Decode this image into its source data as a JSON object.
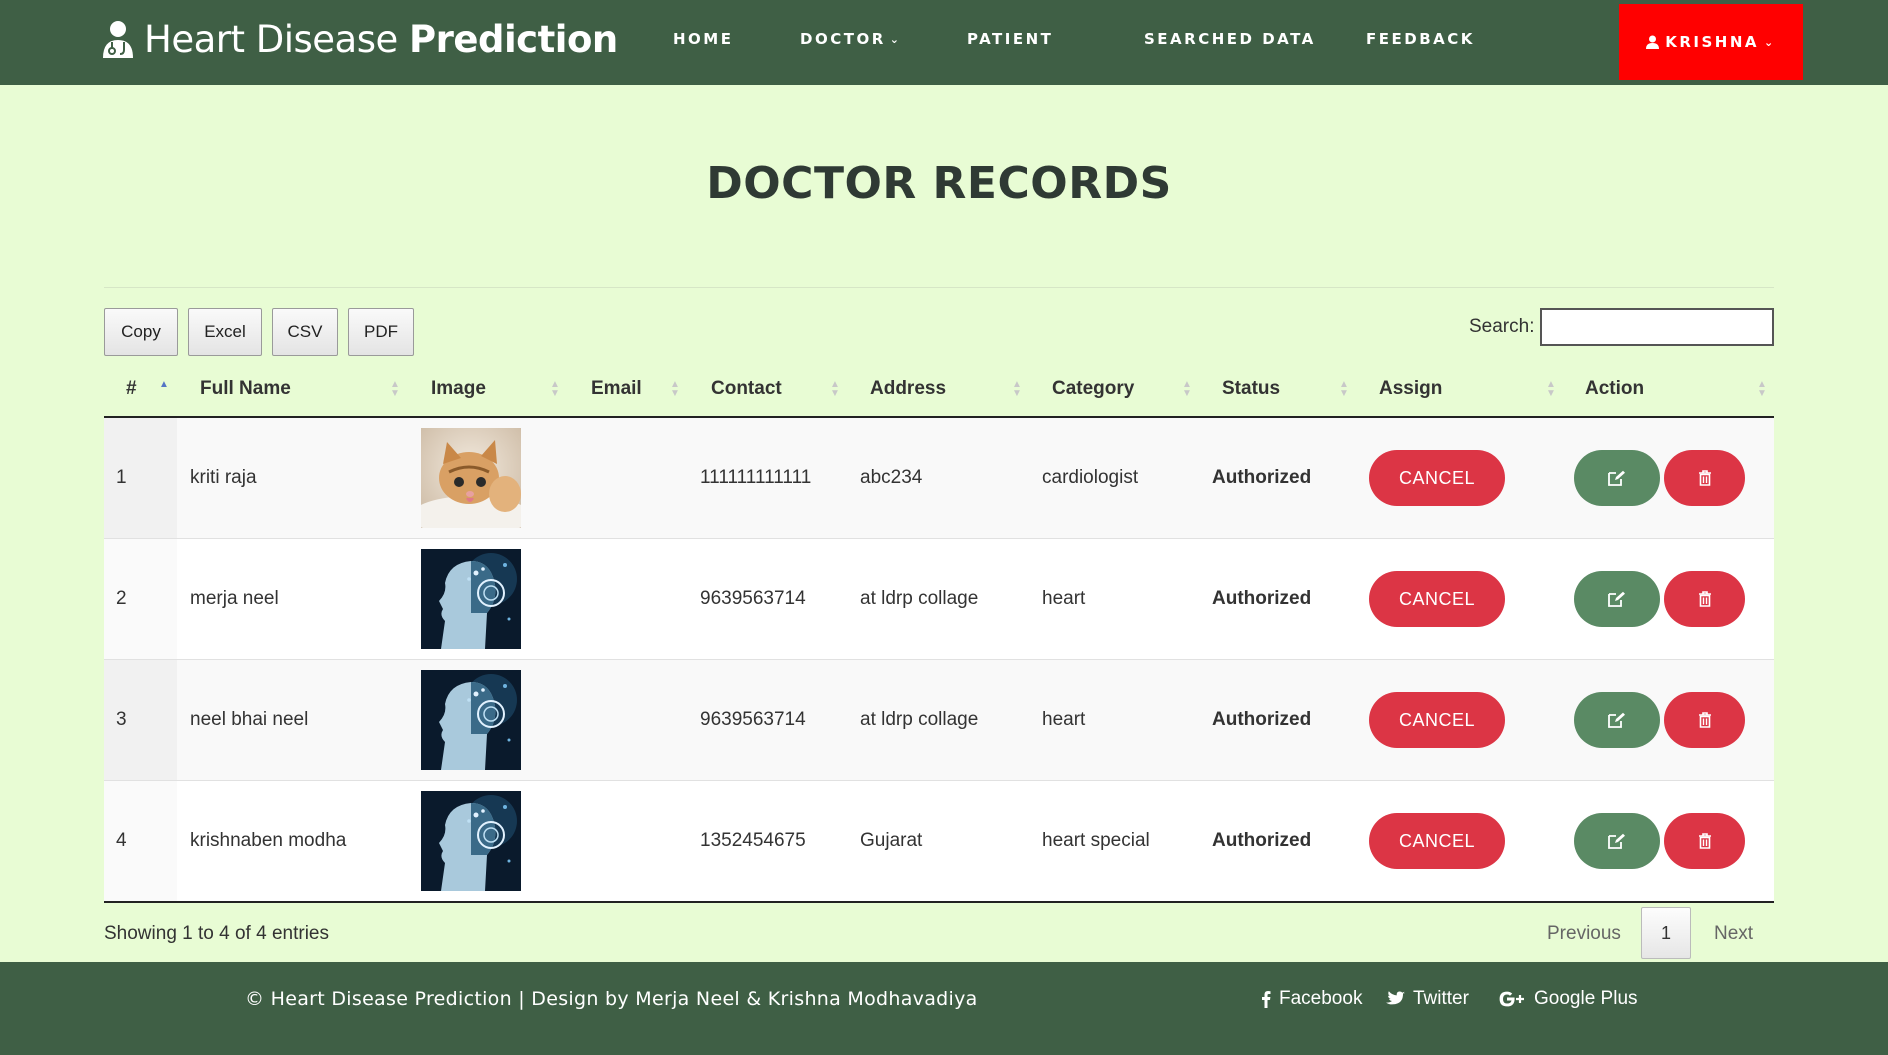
{
  "navbar": {
    "brand_light": "Heart Disease ",
    "brand_bold": "Prediction",
    "items": [
      {
        "label": "HOME"
      },
      {
        "label": "DOCTOR"
      },
      {
        "label": "PATIENT"
      },
      {
        "label": "SEARCHED DATA"
      },
      {
        "label": "FEEDBACK"
      }
    ],
    "user_label": "KRISHNA"
  },
  "page": {
    "title": "DOCTOR RECORDS"
  },
  "toolbar": {
    "copy_label": "Copy",
    "excel_label": "Excel",
    "csv_label": "CSV",
    "pdf_label": "PDF",
    "search_label": "Search:",
    "search_value": ""
  },
  "table": {
    "columns": [
      "#",
      "Full Name",
      "Image",
      "Email",
      "Contact",
      "Address",
      "Category",
      "Status",
      "Assign",
      "Action"
    ],
    "rows": [
      {
        "num": "1",
        "name": "kriti raja",
        "image": "kitten-photo",
        "email": "",
        "contact": "111111111111",
        "address": "abc234",
        "category": "cardiologist",
        "status": "Authorized",
        "assign": "CANCEL"
      },
      {
        "num": "2",
        "name": "merja neel",
        "image": "ai-head-photo",
        "email": "",
        "contact": "9639563714",
        "address": "at ldrp collage",
        "category": "heart",
        "status": "Authorized",
        "assign": "CANCEL"
      },
      {
        "num": "3",
        "name": "neel bhai neel",
        "image": "ai-head-photo",
        "email": "",
        "contact": "9639563714",
        "address": "at ldrp collage",
        "category": "heart",
        "status": "Authorized",
        "assign": "CANCEL"
      },
      {
        "num": "4",
        "name": "krishnaben modha",
        "image": "ai-head-photo",
        "email": "",
        "contact": "1352454675",
        "address": "Gujarat",
        "category": "heart special",
        "status": "Authorized",
        "assign": "CANCEL"
      }
    ],
    "sorted_column": "#",
    "sort_direction": "ascending"
  },
  "pagination": {
    "info": "Showing 1 to 4 of 4 entries",
    "previous": "Previous",
    "current_page": "1",
    "next": "Next"
  },
  "footer": {
    "copyright": "© Heart Disease Prediction | Design by Merja Neel & Krishna Modhavadiya",
    "facebook": "Facebook",
    "twitter": "Twitter",
    "google_plus": "Google Plus"
  },
  "icons": {
    "brand": "doctor-icon",
    "user": "user-icon",
    "edit": "edit-icon",
    "delete": "trash-icon"
  },
  "colors": {
    "nav_bg": "#3f5f45",
    "page_bg": "#e8fcd4",
    "user_button": "#ff0000",
    "danger": "#dc3545",
    "edit_button": "#5a8a64"
  }
}
